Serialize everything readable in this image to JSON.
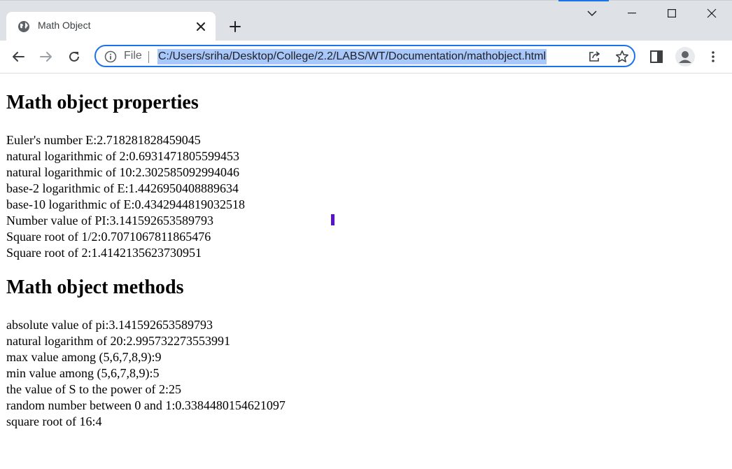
{
  "browser": {
    "tab_title": "Math Object",
    "url_scheme_label": "File",
    "url": "C:/Users/sriha/Desktop/College/2.2/LABS/WT/Documentation/mathobject.html",
    "accent_color": "#1a73e8",
    "selection_color": "#a8c7fa"
  },
  "icons": {
    "favicon": "globe-icon",
    "tab_close": "close-icon",
    "new_tab": "plus-icon",
    "tab_search": "chevron-down-icon",
    "minimize": "minimize-icon",
    "maximize": "maximize-icon",
    "close_window": "close-icon",
    "back": "back-arrow-icon",
    "forward": "forward-arrow-icon",
    "reload": "reload-icon",
    "site_info": "info-icon",
    "share": "share-icon",
    "bookmark": "star-icon",
    "side_panel": "side-panel-icon",
    "profile": "avatar-icon",
    "menu": "kebab-menu-icon"
  },
  "page": {
    "properties_heading": "Math object properties",
    "properties": [
      "Euler's number E:2.718281828459045",
      "natural logarithmic of 2:0.6931471805599453",
      "natural logarithmic of 10:2.302585092994046",
      "base-2 logarithmic of E:1.4426950408889634",
      "base-10 logarithmic of E:0.4342944819032518",
      "Number value of PI:3.141592653589793",
      "Square root of 1/2:0.7071067811865476",
      "Square root of 2:1.4142135623730951"
    ],
    "methods_heading": "Math object methods",
    "methods": [
      "absolute value of pi:3.141592653589793",
      "natural logarithm of 20:2.995732273553991",
      "max value among (5,6,7,8,9):9",
      "min value among (5,6,7,8,9):5",
      "the value of S to the power of 2:25",
      "random number between 0 and 1:0.3384480154621097",
      "square root of 16:4"
    ]
  }
}
